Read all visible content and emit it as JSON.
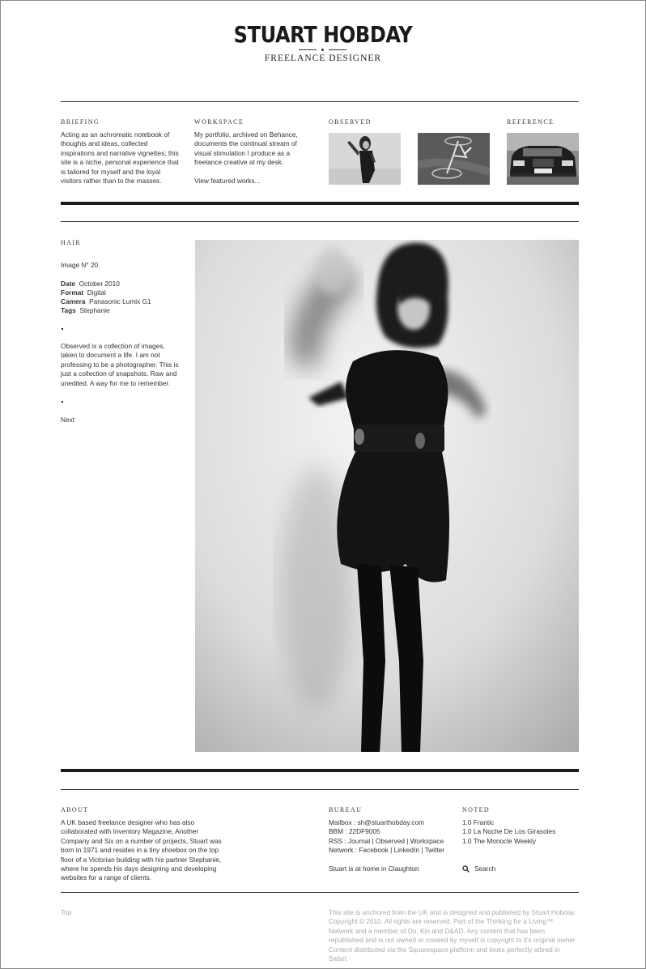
{
  "header": {
    "title": "STUART HOBDAY",
    "subtitle": "FREELANCE DESIGNER"
  },
  "nav": {
    "briefing": {
      "label": "BRIEFING",
      "text": "Acting as an achromatic notebook of thoughts and ideas, collected inspirations and narrative vignettes; this site is a niche, personal experience that is tailored for myself and the loyal visitors rather than to the masses."
    },
    "workspace": {
      "label": "WORKSPACE",
      "text": "My portfolio, archived on Behance, documents the continual stream of visual stimulation I produce as a freelance creative at my desk.",
      "link": "View featured works..."
    },
    "observed": {
      "label": "OBSERVED"
    },
    "reference": {
      "label": "REFERENCE"
    }
  },
  "post": {
    "category": "HAIR",
    "image_title": "Image N° 20",
    "meta": [
      {
        "key": "Date",
        "value": "October 2010"
      },
      {
        "key": "Format",
        "value": "Digital"
      },
      {
        "key": "Camera",
        "value": "Panasonic Lumix G1"
      },
      {
        "key": "Tags",
        "value": "Stephanie"
      }
    ],
    "description": "Observed is a collection of images, taken to document a life. I am not professing to be a photographer. This is just a collection of snapshots. Raw and unedited. A way for me to remember.",
    "next_label": "Next"
  },
  "footer": {
    "about": {
      "label": "ABOUT",
      "text": "A UK based freelance designer who has also collaborated with Inventory Magazine, Another Company and Six on a number of projects, Stuart was born in 1971 and resides in a tiny shoebox on the top floor of a Victorian building with his partner Stephanie, where he spends his days designing and developing websites for a range of clients."
    },
    "bureau": {
      "label": "BUREAU",
      "mailbox": "Mailbox : sh@stuarthobday.com",
      "bbm": "BBM : 22DF9005",
      "rss_prefix": "RSS : ",
      "rss_links": [
        "Journal",
        "Observed",
        "Workspace"
      ],
      "network_prefix": "Network : ",
      "network_links": [
        "Facebook",
        "LinkedIn",
        "Twitter"
      ],
      "separator": " | ",
      "status": "Stuart is at home in Claughton"
    },
    "noted": {
      "label": "NOTED",
      "items": [
        "1.0 Frantic",
        "1.0 La Noche De Los Girasoles",
        "1.0 The Monocle Weekly"
      ],
      "search_label": "Search"
    },
    "top_label": "Top",
    "legal": "This site is anchored from the UK and is designed and published by Stuart Hobday. Copyright © 2010. All rights are reserved. Part of the Thinking for a Living™ Network and a member of Do, Kin and D&AD. Any content that has been republished and is not owned or created by myself is copyright to it's original owner. Content distributed via the Squarespace platform and looks perfectly attired in Safari."
  },
  "colors": {
    "text": "#222222",
    "rule": "#333333",
    "muted": "#aaaaaa"
  },
  "icons": [
    "search-icon"
  ]
}
